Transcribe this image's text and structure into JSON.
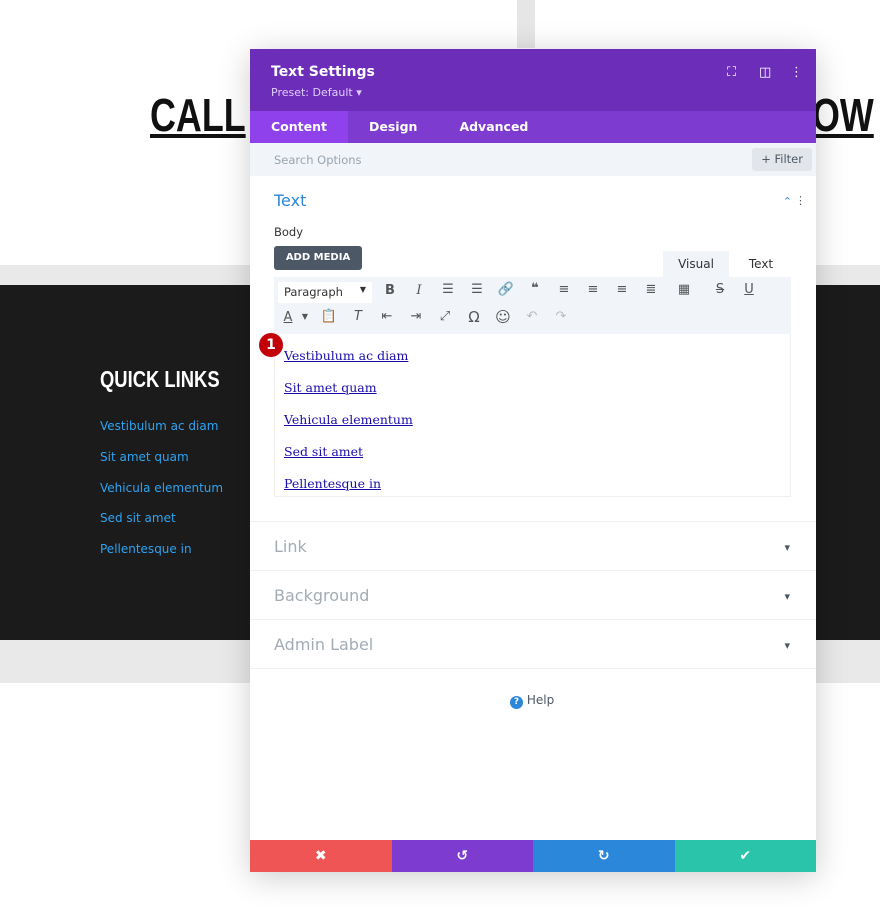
{
  "background": {
    "heading_left": "CALL",
    "heading_right": "OW",
    "footer_title": "QUICK LINKS",
    "footer_links": [
      "Vestibulum ac diam",
      "Sit amet quam",
      "Vehicula elementum",
      "Sed sit amet",
      "Pellentesque in"
    ]
  },
  "modal": {
    "title": "Text Settings",
    "preset": "Preset: Default ▾",
    "tabs": [
      "Content",
      "Design",
      "Advanced"
    ],
    "search_placeholder": "Search Options",
    "filter": "+ Filter",
    "text_section": {
      "title": "Text",
      "body_label": "Body",
      "add_media": "ADD MEDIA",
      "visual_tab": "Visual",
      "text_tab": "Text",
      "paragraph_select": "Paragraph",
      "badge": "1",
      "links": [
        "Vestibulum ac diam",
        "Sit amet quam",
        "Vehicula elementum",
        "Sed sit amet",
        "Pellentesque in"
      ]
    },
    "sections": [
      "Link",
      "Background",
      "Admin Label"
    ],
    "help": "Help"
  },
  "colors": {
    "header": "#6c2eb9",
    "tabs": "#7e3bd0",
    "cancel": "#ef5555",
    "undo": "#7e3bd0",
    "redo": "#2b87da",
    "save": "#29c4a9"
  }
}
